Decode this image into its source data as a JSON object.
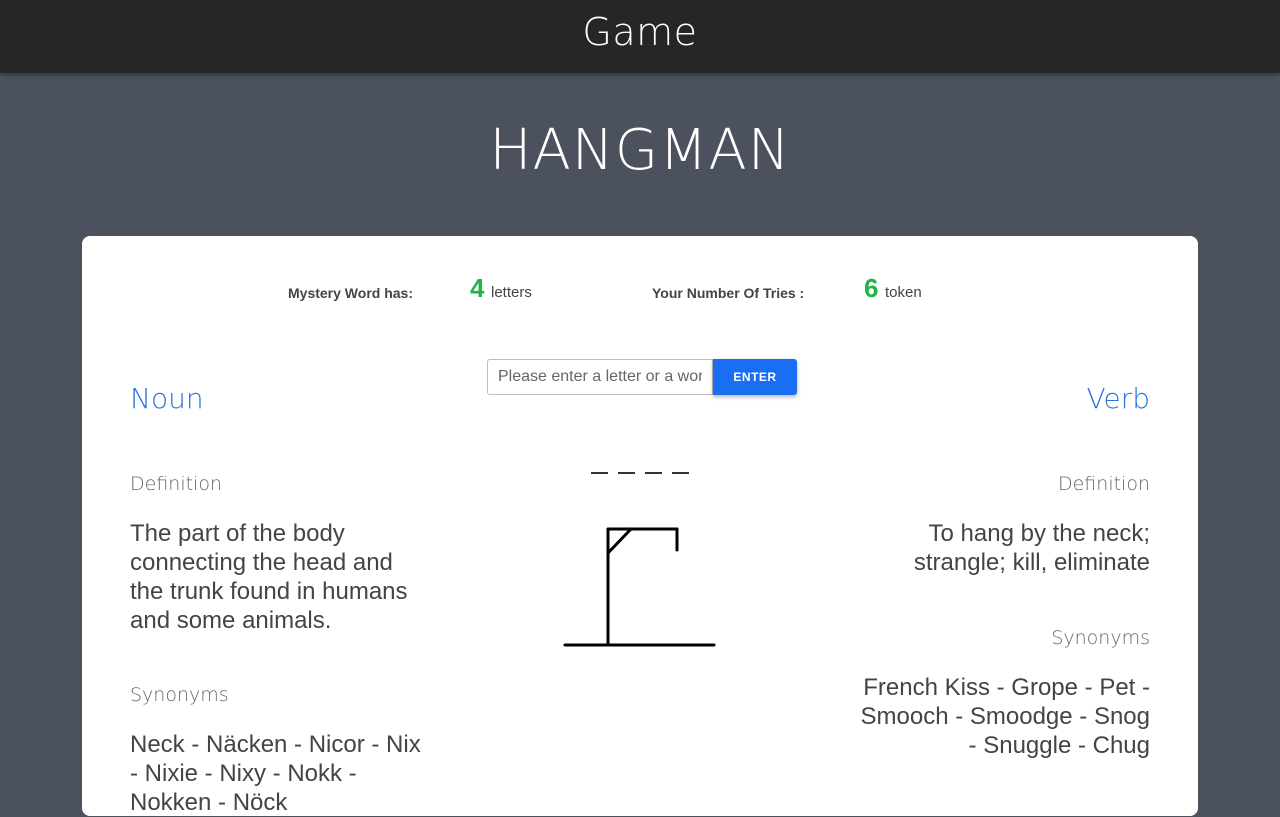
{
  "header": {
    "title": "Game"
  },
  "game": {
    "title": "HANGMAN",
    "stats": {
      "word_label": "Mystery Word has:",
      "word_count": "4",
      "word_unit": "letters",
      "tries_label": "Your Number Of Tries :",
      "tries_count": "6",
      "tries_unit": "token"
    },
    "input": {
      "placeholder": "Please enter a letter or a word",
      "value": ""
    },
    "enter_label": "ENTER",
    "slots": [
      "",
      "",
      "",
      ""
    ]
  },
  "noun": {
    "heading": "Noun",
    "definition_label": "Definition",
    "definition": "The part of the body connecting the head and the trunk found in humans and some animals.",
    "synonyms_label": "Synonyms",
    "synonyms": "Neck - Näcken - Nicor - Nix - Nixie - Nixy - Nokk - Nokken - Nöck"
  },
  "verb": {
    "heading": "Verb",
    "definition_label": "Definition",
    "definition": "To hang by the neck; strangle; kill, eliminate",
    "synonyms_label": "Synonyms",
    "synonyms": "French Kiss - Grope - Pet - Smooch - Smoodge - Snog - Snuggle - Chug"
  },
  "colors": {
    "header_bg": "#262626",
    "page_bg": "#4b525e",
    "accent_blue": "#2a73d9",
    "button_blue": "#1a6ef2",
    "count_green": "#1eb548"
  }
}
